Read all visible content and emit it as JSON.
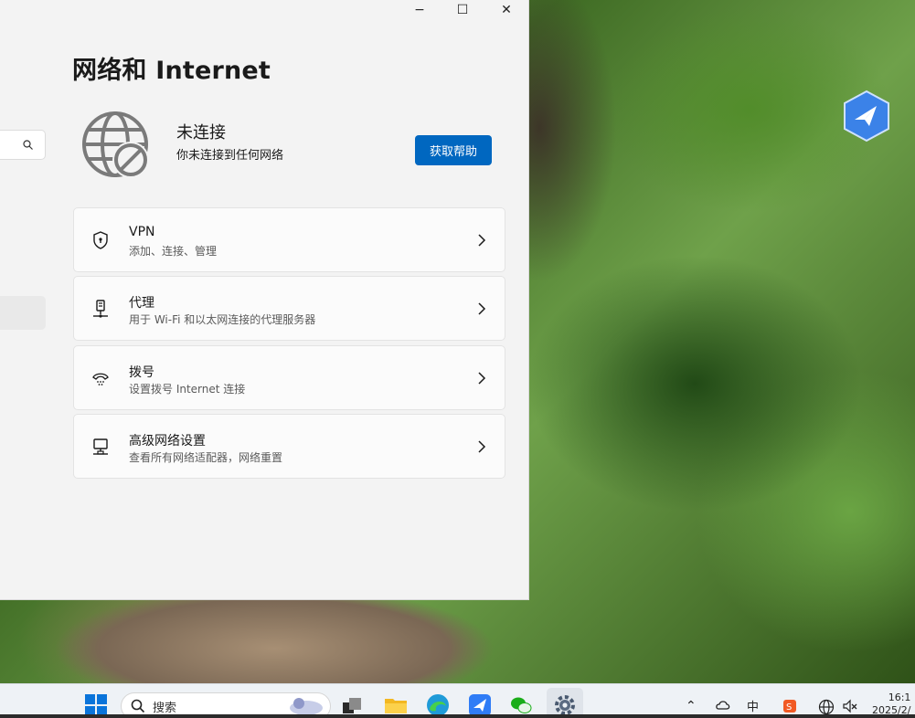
{
  "window": {
    "title": "网络和 Internet",
    "caption": {
      "minimize": "−",
      "maximize": "☐",
      "close": "✕"
    }
  },
  "status": {
    "title": "未连接",
    "subtitle": "你未连接到任何网络",
    "help_button": "获取帮助"
  },
  "items": [
    {
      "title": "VPN",
      "subtitle": "添加、连接、管理",
      "icon": "shield-icon"
    },
    {
      "title": "代理",
      "subtitle": "用于 Wi-Fi 和以太网连接的代理服务器",
      "icon": "proxy-icon"
    },
    {
      "title": "拨号",
      "subtitle": "设置拨号 Internet 连接",
      "icon": "dialup-icon"
    },
    {
      "title": "高级网络设置",
      "subtitle": "查看所有网络适配器，网络重置",
      "icon": "network-adapter-icon"
    }
  ],
  "taskbar": {
    "search_placeholder": "搜索",
    "ime": "中",
    "clock_time": "16:1",
    "clock_date": "2025/2/"
  },
  "colors": {
    "accent": "#0067c0",
    "window_bg": "#f3f3f3"
  }
}
